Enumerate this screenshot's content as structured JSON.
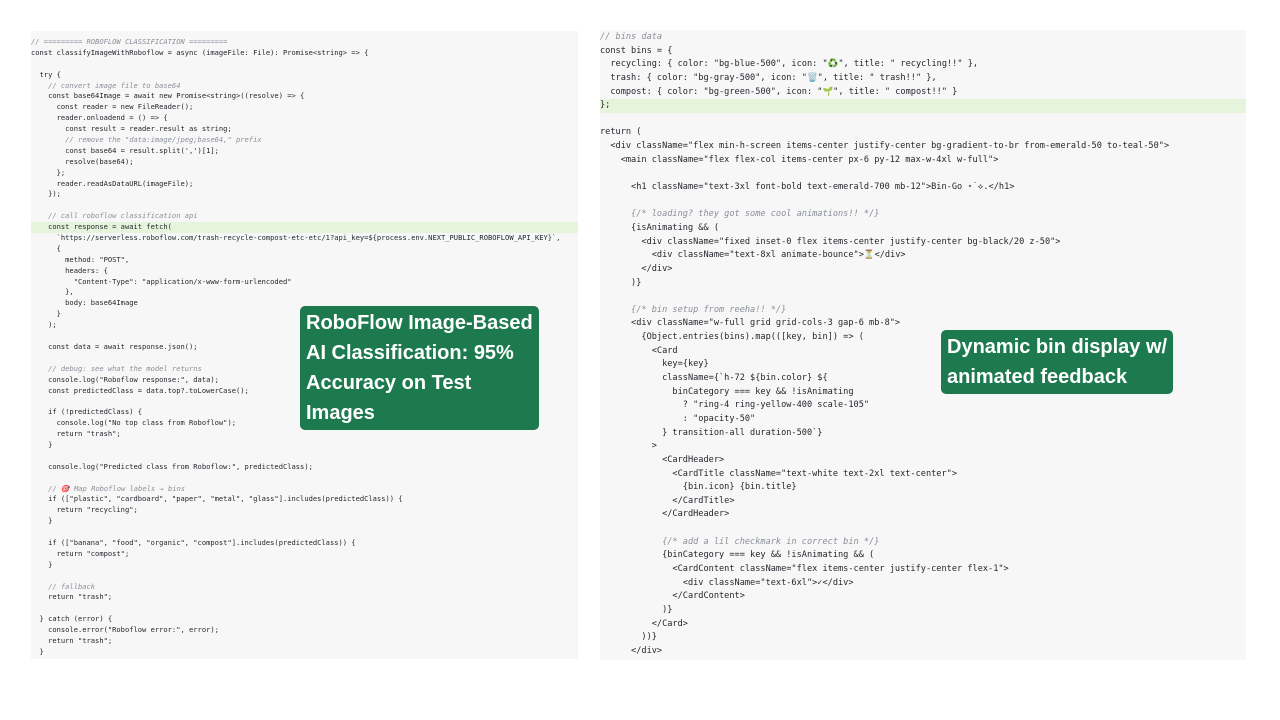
{
  "left_panel": {
    "lines": [
      {
        "text": "// ========= ROBOFLOW CLASSIFICATION =========",
        "style": "cm"
      },
      {
        "text": "const classifyImageWithRoboflow = async (imageFile: File): Promise<string> => {"
      },
      {
        "text": ""
      },
      {
        "text": "  try {"
      },
      {
        "text": "    // convert image file to base64",
        "style": "cm"
      },
      {
        "text": "    const base64Image = await new Promise<string>((resolve) => {"
      },
      {
        "text": "      const reader = new FileReader();"
      },
      {
        "text": "      reader.onloadend = () => {"
      },
      {
        "text": "        const result = reader.result as string;"
      },
      {
        "text": "        // remove the \"data:image/jpeg;base64,\" prefix",
        "style": "cm"
      },
      {
        "text": "        const base64 = result.split(',')[1];"
      },
      {
        "text": "        resolve(base64);"
      },
      {
        "text": "      };"
      },
      {
        "text": "      reader.readAsDataURL(imageFile);"
      },
      {
        "text": "    });"
      },
      {
        "text": ""
      },
      {
        "text": "    // call roboflow classification api",
        "style": "cm"
      },
      {
        "text": "    const response = await fetch(",
        "style": "hl"
      },
      {
        "text": "      `https://serverless.roboflow.com/trash-recycle-compost-etc-etc/1?api_key=${process.env.NEXT_PUBLIC_ROBOFLOW_API_KEY}`,"
      },
      {
        "text": "      {"
      },
      {
        "text": "        method: \"POST\","
      },
      {
        "text": "        headers: {"
      },
      {
        "text": "          \"Content-Type\": \"application/x-www-form-urlencoded\""
      },
      {
        "text": "        },"
      },
      {
        "text": "        body: base64Image"
      },
      {
        "text": "      }"
      },
      {
        "text": "    );"
      },
      {
        "text": ""
      },
      {
        "text": "    const data = await response.json();"
      },
      {
        "text": ""
      },
      {
        "text": "    // debug: see what the model returns",
        "style": "cm"
      },
      {
        "text": "    console.log(\"Roboflow response:\", data);"
      },
      {
        "text": "    const predictedClass = data.top?.toLowerCase();"
      },
      {
        "text": ""
      },
      {
        "text": "    if (!predictedClass) {"
      },
      {
        "text": "      console.log(\"No top class from Roboflow\");"
      },
      {
        "text": "      return \"trash\";"
      },
      {
        "text": "    }"
      },
      {
        "text": ""
      },
      {
        "text": "    console.log(\"Predicted class from Roboflow:\", predictedClass);"
      },
      {
        "text": ""
      },
      {
        "text": "    // 🎯 Map Roboflow labels → bins",
        "style": "cm"
      },
      {
        "text": "    if ([\"plastic\", \"cardboard\", \"paper\", \"metal\", \"glass\"].includes(predictedClass)) {"
      },
      {
        "text": "      return \"recycling\";"
      },
      {
        "text": "    }"
      },
      {
        "text": ""
      },
      {
        "text": "    if ([\"banana\", \"food\", \"organic\", \"compost\"].includes(predictedClass)) {"
      },
      {
        "text": "      return \"compost\";"
      },
      {
        "text": "    }"
      },
      {
        "text": ""
      },
      {
        "text": "    // fallback",
        "style": "cm"
      },
      {
        "text": "    return \"trash\";"
      },
      {
        "text": ""
      },
      {
        "text": "  } catch (error) {"
      },
      {
        "text": "    console.error(\"Roboflow error:\", error);"
      },
      {
        "text": "    return \"trash\";"
      },
      {
        "text": "  }"
      },
      {
        "text": "};"
      }
    ]
  },
  "right_panel": {
    "lines": [
      {
        "text": "// bins data",
        "style": "cm"
      },
      {
        "text": "const bins = {"
      },
      {
        "text": "  recycling: { color: \"bg-blue-500\", icon: \"♻️\", title: \" recycling!!\" },"
      },
      {
        "text": "  trash: { color: \"bg-gray-500\", icon: \"🗑️\", title: \" trash!!\" },"
      },
      {
        "text": "  compost: { color: \"bg-green-500\", icon: \"🌱\", title: \" compost!!\" }"
      },
      {
        "text": "};",
        "style": "hl"
      },
      {
        "text": ""
      },
      {
        "text": "return ("
      },
      {
        "text": "  <div className=\"flex min-h-screen items-center justify-center bg-gradient-to-br from-emerald-50 to-teal-50\">"
      },
      {
        "text": "    <main className=\"flex flex-col items-center px-6 py-12 max-w-4xl w-full\">"
      },
      {
        "text": ""
      },
      {
        "text": "      <h1 className=\"text-3xl font-bold text-emerald-700 mb-12\">Bin-Go ⋆˙⟡.</h1>"
      },
      {
        "text": ""
      },
      {
        "text": "      {/* loading? they got some cool animations!! */}",
        "style": "cm"
      },
      {
        "text": "      {isAnimating && ("
      },
      {
        "text": "        <div className=\"fixed inset-0 flex items-center justify-center bg-black/20 z-50\">"
      },
      {
        "text": "          <div className=\"text-8xl animate-bounce\">⏳</div>"
      },
      {
        "text": "        </div>"
      },
      {
        "text": "      )}"
      },
      {
        "text": ""
      },
      {
        "text": "      {/* bin setup from reeha!! */}",
        "style": "cm"
      },
      {
        "text": "      <div className=\"w-full grid grid-cols-3 gap-6 mb-8\">"
      },
      {
        "text": "        {Object.entries(bins).map(([key, bin]) => ("
      },
      {
        "text": "          <Card"
      },
      {
        "text": "            key={key}"
      },
      {
        "text": "            className={`h-72 ${bin.color} ${"
      },
      {
        "text": "              binCategory === key && !isAnimating"
      },
      {
        "text": "                ? \"ring-4 ring-yellow-400 scale-105\""
      },
      {
        "text": "                : \"opacity-50\""
      },
      {
        "text": "            } transition-all duration-500`}"
      },
      {
        "text": "          >"
      },
      {
        "text": "            <CardHeader>"
      },
      {
        "text": "              <CardTitle className=\"text-white text-2xl text-center\">"
      },
      {
        "text": "                {bin.icon} {bin.title}"
      },
      {
        "text": "              </CardTitle>"
      },
      {
        "text": "            </CardHeader>"
      },
      {
        "text": ""
      },
      {
        "text": "            {/* add a lil checkmark in correct bin */}",
        "style": "cm"
      },
      {
        "text": "            {binCategory === key && !isAnimating && ("
      },
      {
        "text": "              <CardContent className=\"flex items-center justify-center flex-1\">"
      },
      {
        "text": "                <div className=\"text-6xl\">✓</div>"
      },
      {
        "text": "              </CardContent>"
      },
      {
        "text": "            )}"
      },
      {
        "text": "          </Card>"
      },
      {
        "text": "        ))}"
      },
      {
        "text": "      </div>"
      }
    ]
  },
  "callouts": {
    "roboflow": {
      "lines": [
        "RoboFlow Image-Based",
        "AI Classification: 95%",
        "Accuracy on Test",
        "Images"
      ]
    },
    "bins": {
      "lines": [
        "Dynamic bin display w/",
        "animated feedback"
      ]
    }
  }
}
